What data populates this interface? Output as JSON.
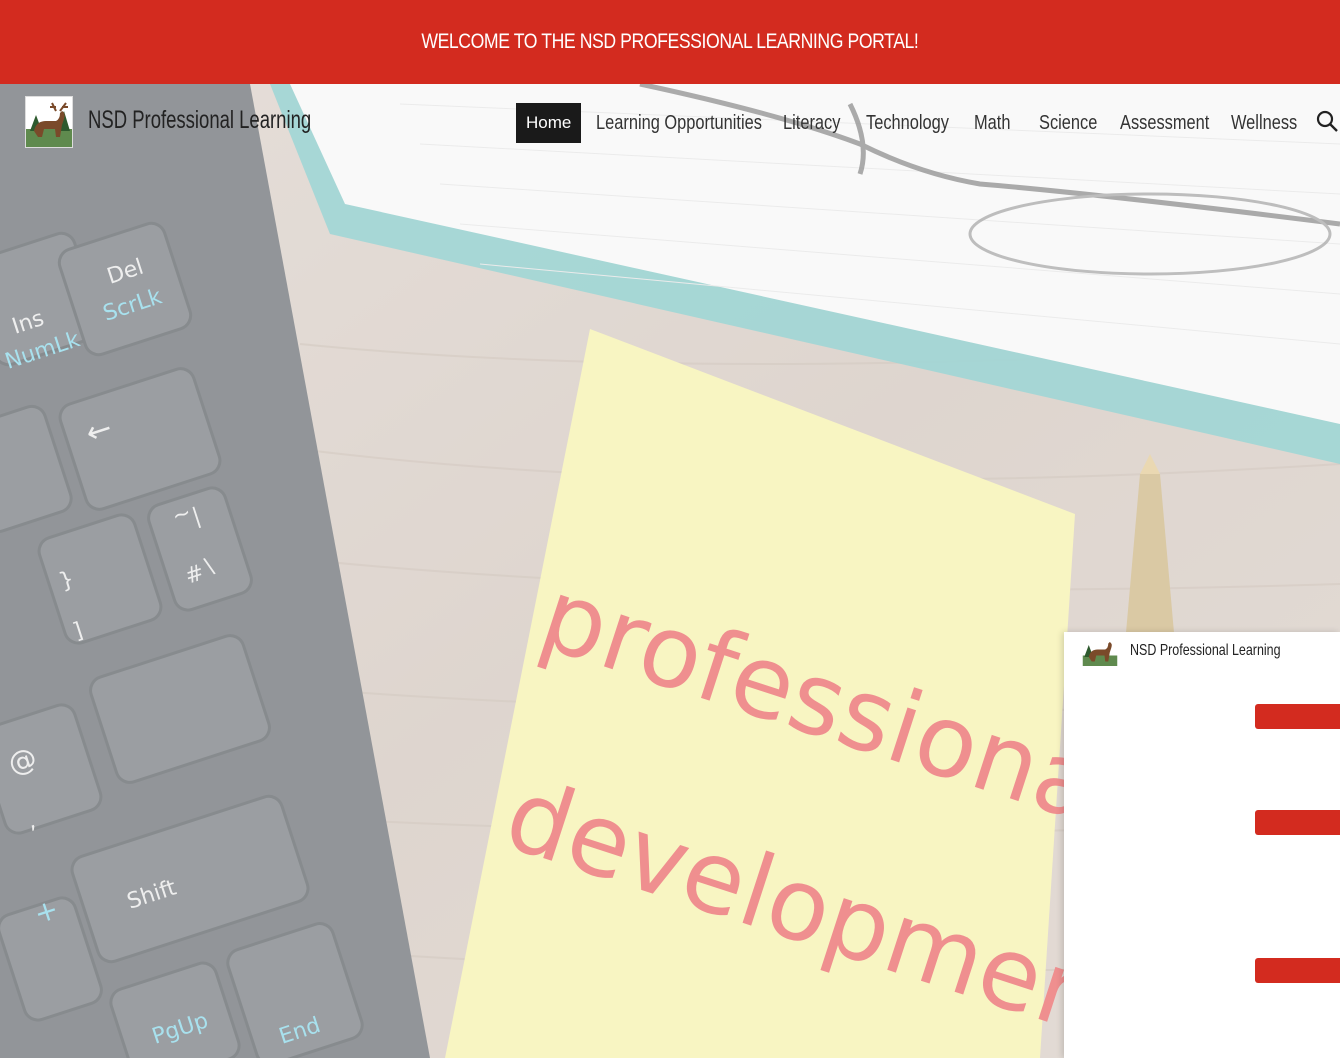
{
  "banner": {
    "text": "WELCOME TO THE NSD PROFESSIONAL LEARNING PORTAL!"
  },
  "header": {
    "site_title": "NSD Professional Learning"
  },
  "nav": {
    "items": [
      {
        "label": "Home",
        "active": true
      },
      {
        "label": "Learning Opportunities"
      },
      {
        "label": "Literacy"
      },
      {
        "label": "Technology"
      },
      {
        "label": "Math"
      },
      {
        "label": "Science"
      },
      {
        "label": "Assessment"
      },
      {
        "label": "Wellness"
      }
    ],
    "search_icon": "search-icon"
  },
  "hero": {
    "note_line1": "professional",
    "note_line2": "development",
    "keys": {
      "ins": "Ins",
      "numlk": "NumLk",
      "del": "Del",
      "scrlk": "ScrLk",
      "shift": "Shift",
      "pgup": "PgUp",
      "end": "End",
      "at": "@",
      "plus": "+",
      "hash": "#",
      "backslash": "\\",
      "tilde": "~",
      "pipe": "|",
      "brace": "}",
      "bracket": "]",
      "comma": ","
    }
  },
  "panel": {
    "title": "NSD Professional Learning"
  },
  "colors": {
    "accent": "#d32b1f",
    "active_nav_bg": "#1a1a1a"
  }
}
